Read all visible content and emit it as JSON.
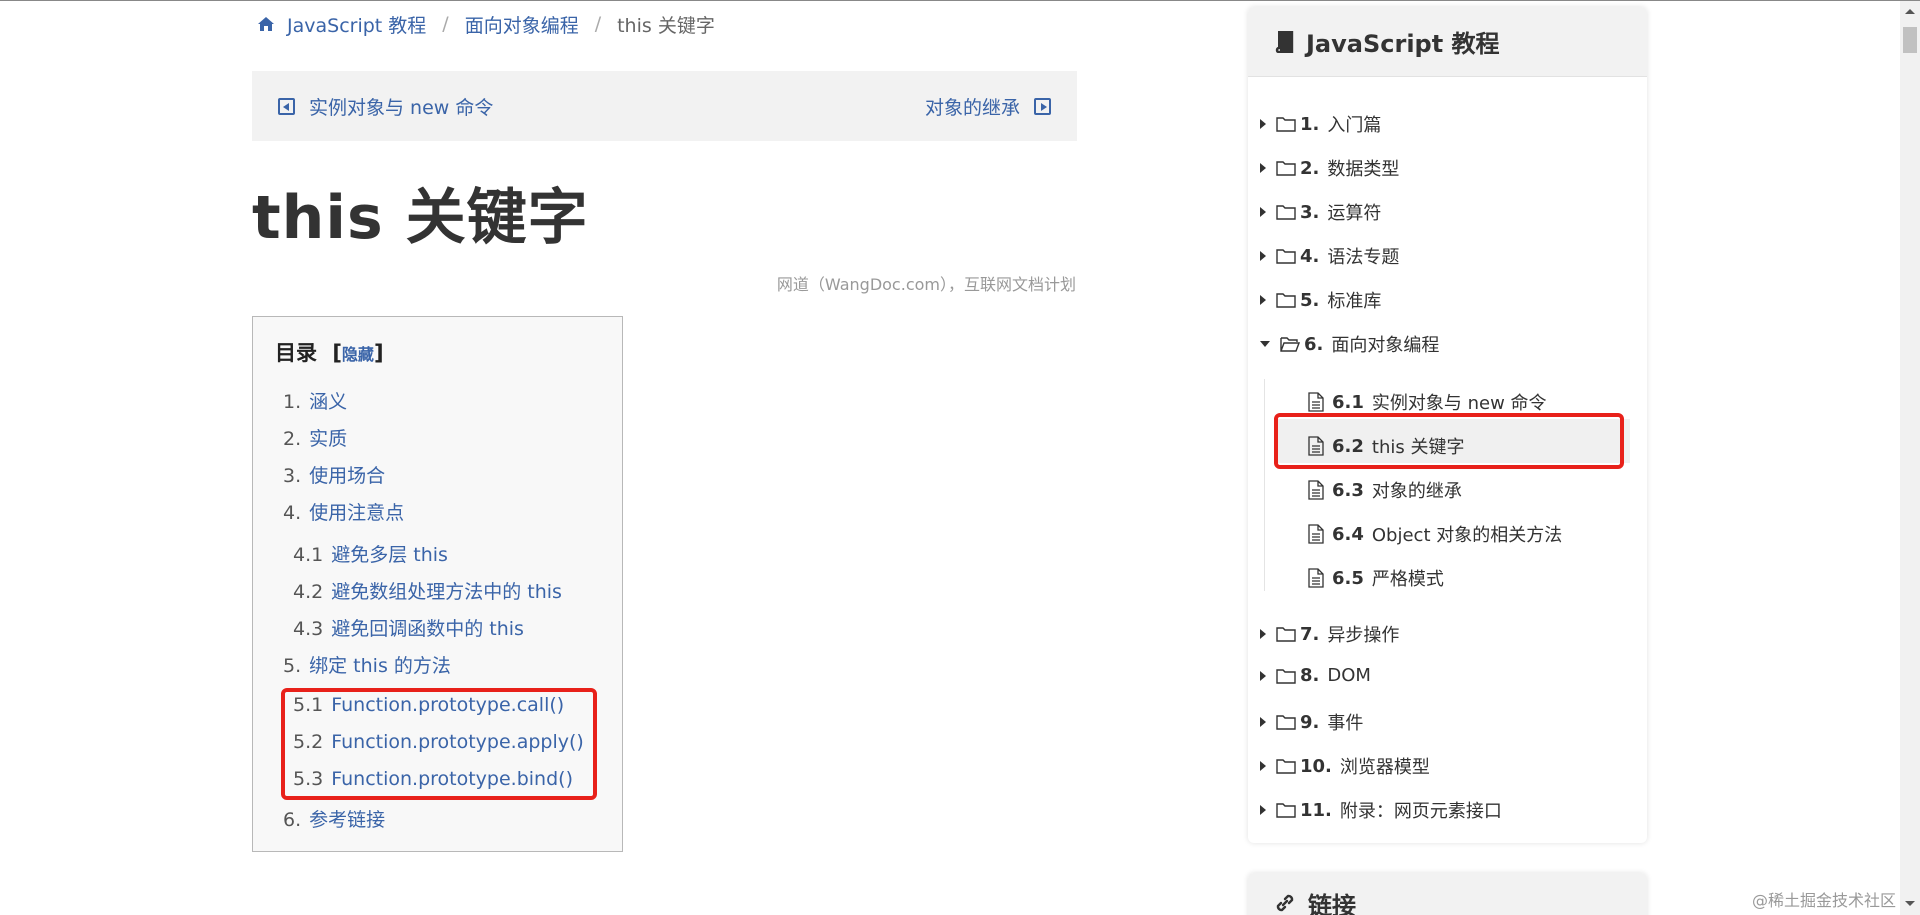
{
  "breadcrumb": {
    "items": [
      "JavaScript 教程",
      "面向对象编程"
    ],
    "separator": "/",
    "current": "this 关键字"
  },
  "pager": {
    "prev_label": "实例对象与 new 命令",
    "next_label": "对象的继承"
  },
  "page_title": "this 关键字",
  "source_note": "网道（WangDoc.com），互联网文档计划",
  "toc": {
    "title": "目录",
    "open_bracket": "[",
    "hide_label": "隐藏",
    "close_bracket": "]",
    "items": [
      {
        "num": "1.",
        "text": "涵义"
      },
      {
        "num": "2.",
        "text": "实质"
      },
      {
        "num": "3.",
        "text": "使用场合"
      },
      {
        "num": "4.",
        "text": "使用注意点"
      },
      {
        "num": "4.1",
        "text": "避免多层 this"
      },
      {
        "num": "4.2",
        "text": "避免数组处理方法中的 this"
      },
      {
        "num": "4.3",
        "text": "避免回调函数中的 this"
      },
      {
        "num": "5.",
        "text": "绑定 this 的方法"
      },
      {
        "num": "5.1",
        "text": "Function.prototype.call()"
      },
      {
        "num": "5.2",
        "text": "Function.prototype.apply()"
      },
      {
        "num": "5.3",
        "text": "Function.prototype.bind()"
      },
      {
        "num": "6.",
        "text": "参考链接"
      }
    ]
  },
  "sidebar": {
    "title": "JavaScript 教程",
    "chapters": [
      {
        "num": "1.",
        "text": "入门篇",
        "expanded": false
      },
      {
        "num": "2.",
        "text": "数据类型",
        "expanded": false
      },
      {
        "num": "3.",
        "text": "运算符",
        "expanded": false
      },
      {
        "num": "4.",
        "text": "语法专题",
        "expanded": false
      },
      {
        "num": "5.",
        "text": "标准库",
        "expanded": false
      },
      {
        "num": "6.",
        "text": "面向对象编程",
        "expanded": true
      },
      {
        "num": "7.",
        "text": "异步操作",
        "expanded": false
      },
      {
        "num": "8.",
        "text": "DOM",
        "expanded": false
      },
      {
        "num": "9.",
        "text": "事件",
        "expanded": false
      },
      {
        "num": "10.",
        "text": "浏览器模型",
        "expanded": false
      },
      {
        "num": "11.",
        "text": "附录：网页元素接口",
        "expanded": false
      }
    ],
    "sub_items": [
      {
        "num": "6.1",
        "text": "实例对象与 new 命令"
      },
      {
        "num": "6.2",
        "text": "this 关键字",
        "active": true
      },
      {
        "num": "6.3",
        "text": "对象的继承"
      },
      {
        "num": "6.4",
        "text": "Object 对象的相关方法"
      },
      {
        "num": "6.5",
        "text": "严格模式"
      }
    ],
    "links_title": "链接"
  },
  "watermark": "@稀土掘金技术社区",
  "colors": {
    "link": "#3a64a8",
    "highlight_border": "#e8211a",
    "pager_bg": "#f2f2f2"
  }
}
